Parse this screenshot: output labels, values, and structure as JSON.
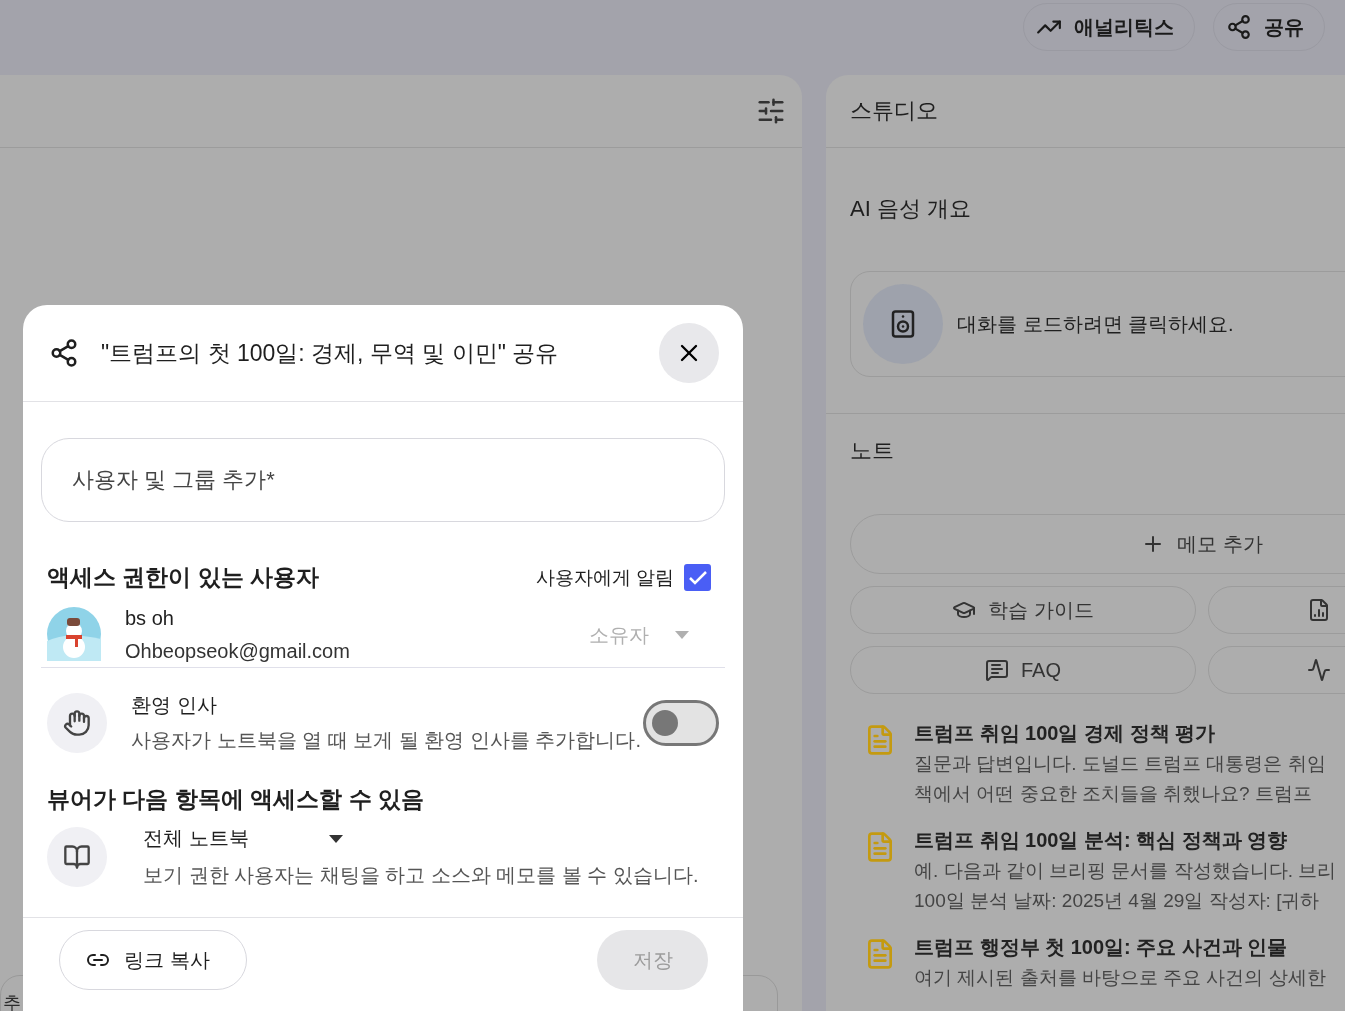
{
  "header": {
    "buttons": [
      {
        "kind": "analytics",
        "label": "애널리틱스"
      },
      {
        "kind": "share",
        "label": "공유"
      }
    ]
  },
  "chat": {
    "bottom_fragment": "추"
  },
  "studio": {
    "title": "스튜디오",
    "audio_overview": {
      "heading": "AI 음성 개요",
      "prompt": "대화를 로드하려면 클릭하세요."
    },
    "notes": {
      "heading": "노트",
      "add_button": "메모 추가",
      "actions": [
        {
          "kind": "study",
          "label": "학습 가이드"
        },
        {
          "kind": "briefing"
        },
        {
          "kind": "faq",
          "label": "FAQ"
        },
        {
          "kind": "timeline"
        }
      ],
      "items": [
        {
          "title": "트럼프 취임 100일 경제 정책 평가",
          "lines": [
            "질문과 답변입니다. 도널드 트럼프 대통령은 취임",
            "책에서 어떤 중요한 조치들을 취했나요? 트럼프"
          ]
        },
        {
          "title": "트럼프 취임 100일 분석: 핵심 정책과 영향",
          "lines": [
            "예. 다음과 같이 브리핑 문서를 작성했습니다. 브리",
            "100일 분석 날짜: 2025년 4월 29일 작성자: [귀하"
          ]
        },
        {
          "title": "트럼프 행정부 첫 100일: 주요 사건과 인물",
          "lines": [
            "여기 제시된 출처를 바탕으로 주요 사건의 상세한"
          ]
        }
      ]
    }
  },
  "dialog": {
    "title": "\"트럼프의 첫 100일: 경제, 무역 및 이민\" 공유",
    "add_field": {
      "placeholder": "사용자 및 그룹 추가*"
    },
    "access": {
      "heading": "액세스 권한이 있는 사용자",
      "notify": {
        "label": "사용자에게 알림",
        "checked": true
      },
      "users": [
        {
          "name": "bs oh",
          "email": "Ohbeopseok@gmail.com",
          "role": "소유자",
          "disabled": true
        }
      ]
    },
    "welcome": {
      "title": "환영 인사",
      "description": "사용자가 노트북을 열 때 보게 될 환영 인사를 추가합니다.",
      "on": false
    },
    "viewer": {
      "heading": "뷰어가 다음 항목에 액세스할 수 있음",
      "scope": "전체 노트북",
      "description": "보기 권한 사용자는 채팅을 하고 소스와 메모를 볼 수 있습니다."
    },
    "footer": {
      "copy_link": "링크 복사",
      "save": {
        "label": "저장",
        "disabled": true
      }
    }
  }
}
